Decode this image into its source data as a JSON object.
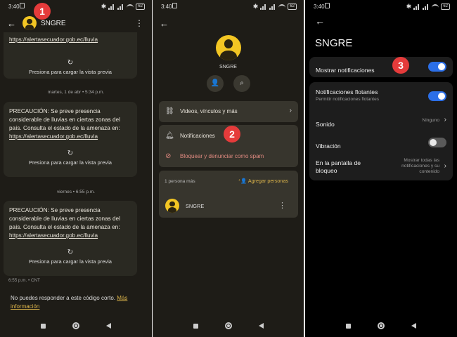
{
  "status_time": "3:40",
  "battery": "62",
  "screen1": {
    "title": "SNGRE",
    "top_link": "https://alertasecuador.gob.ec/lluvia",
    "preview_label": "Presiona para cargar la vista previa",
    "dates": [
      "martes, 1 de abr • 5:34 p.m.",
      "viernes • 6:55 p.m."
    ],
    "message": "PRECAUCIÓN: Se preve presencia considerable de lluvias en ciertas zonas del país. Consulta el estado de la amenaza en:",
    "message_link": "https://alertasecuador.gob.ec/lluvia",
    "footer_meta": "6:55 p.m. • CNT",
    "reply_note": "No puedes responder a este código corto.",
    "more_info_link": "Más información",
    "badge": "1"
  },
  "screen2": {
    "name": "SNGRE",
    "media_row": "Videos, vínculos y más",
    "notifications_row": "Notificaciones",
    "block_row": "Bloquear y denunciar como spam",
    "people_count": "1 persona más",
    "add_people": "Agregar personas",
    "member_name": "SNGRE",
    "badge": "2",
    "icons": [
      "person-add-icon",
      "search-icon",
      "link-icon",
      "bell-icon",
      "block-icon"
    ]
  },
  "screen3": {
    "title": "SNGRE",
    "show_notifications": "Mostrar notificaciones",
    "show_notifications_on": true,
    "floating_title": "Notificaciones flotantes",
    "floating_sub": "Permitir notificaciones flotantes",
    "floating_on": true,
    "sound_label": "Sonido",
    "sound_value": "Ninguno",
    "vibration_label": "Vibración",
    "vibration_on": false,
    "lock_label": "En la pantalla de bloqueo",
    "lock_value": "Mostrar todas las notificaciones y su contenido",
    "badge": "3"
  },
  "colors": {
    "accent_blue": "#2b6fe8",
    "avatar_yellow": "#f3c623",
    "badge_red": "#e53b3b",
    "spam_red": "#e08a80",
    "link_gold": "#d9b24a"
  }
}
